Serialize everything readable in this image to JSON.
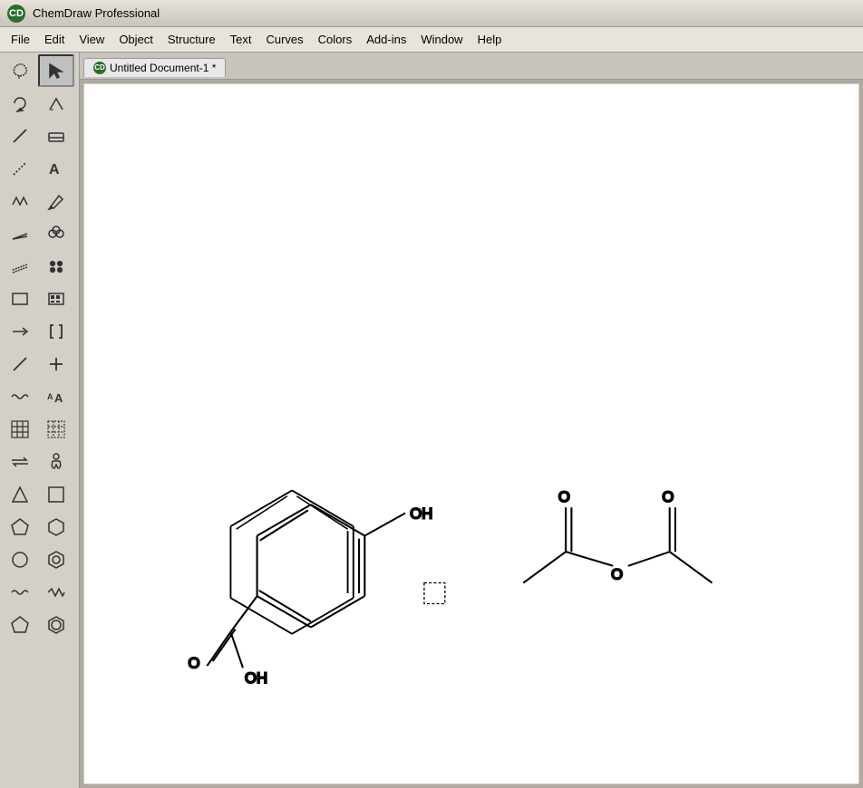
{
  "titleBar": {
    "appIcon": "CD",
    "appTitle": "ChemDraw Professional"
  },
  "menuBar": {
    "items": [
      "File",
      "Edit",
      "View",
      "Object",
      "Structure",
      "Text",
      "Curves",
      "Colors",
      "Add-ins",
      "Window",
      "Help"
    ]
  },
  "docTab": {
    "icon": "CD",
    "title": "Untitled Document-1 *"
  },
  "toolbar": {
    "tools": [
      {
        "name": "lasso-tool",
        "icon": "↺",
        "active": false
      },
      {
        "name": "select-tool",
        "icon": "▢",
        "active": true
      },
      {
        "name": "rotate-tool",
        "icon": "↺",
        "active": false
      },
      {
        "name": "bond-angle-tool",
        "icon": "⌐",
        "active": false
      },
      {
        "name": "bond-tool",
        "icon": "╱",
        "active": false
      },
      {
        "name": "eraser-tool",
        "icon": "▱",
        "active": false
      },
      {
        "name": "dash-bond-tool",
        "icon": "╱",
        "active": false
      },
      {
        "name": "text-tool",
        "icon": "A",
        "active": false
      },
      {
        "name": "chain-tool",
        "icon": "⋯",
        "active": false
      },
      {
        "name": "pen-tool",
        "icon": "✒",
        "active": false
      },
      {
        "name": "wedge-tool",
        "icon": "╱",
        "active": false
      },
      {
        "name": "orbital-tool",
        "icon": "⟲",
        "active": false
      },
      {
        "name": "dashed-wedge-tool",
        "icon": "╱",
        "active": false
      },
      {
        "name": "electron-tool",
        "icon": "✿",
        "active": false
      },
      {
        "name": "rectangle-tool-outline",
        "icon": "▭",
        "active": false
      },
      {
        "name": "rectangle-tool",
        "icon": "▣",
        "active": false
      },
      {
        "name": "arrow-tool",
        "icon": "→",
        "active": false
      },
      {
        "name": "bracket-tool",
        "icon": "[",
        "active": false
      },
      {
        "name": "line-tool",
        "icon": "╲",
        "active": false
      },
      {
        "name": "plus-tool",
        "icon": "+",
        "active": false
      },
      {
        "name": "wavy-tool",
        "icon": "∿",
        "active": false
      },
      {
        "name": "resize-text-tool",
        "icon": "A+A",
        "active": false
      },
      {
        "name": "grid-tool",
        "icon": "⊞",
        "active": false
      },
      {
        "name": "dash-grid-tool",
        "icon": "⋯",
        "active": false
      },
      {
        "name": "reaction-tool",
        "icon": "⇌",
        "active": false
      },
      {
        "name": "figure-tool",
        "icon": "👤",
        "active": false
      },
      {
        "name": "triangle-tool",
        "icon": "△",
        "active": false
      },
      {
        "name": "square-tool",
        "icon": "□",
        "active": false
      },
      {
        "name": "pentagon-tool",
        "icon": "⬠",
        "active": false
      },
      {
        "name": "hexagon-tool",
        "icon": "⬡",
        "active": false
      },
      {
        "name": "circle-tool",
        "icon": "○",
        "active": false
      },
      {
        "name": "hexagon2-tool",
        "icon": "⬡",
        "active": false
      },
      {
        "name": "wave-tool",
        "icon": "∿",
        "active": false
      },
      {
        "name": "zigzag-tool",
        "icon": "〜",
        "active": false
      },
      {
        "name": "pentagon2-tool",
        "icon": "⬠",
        "active": false
      },
      {
        "name": "benzene-tool",
        "icon": "⬡",
        "active": false
      }
    ]
  }
}
